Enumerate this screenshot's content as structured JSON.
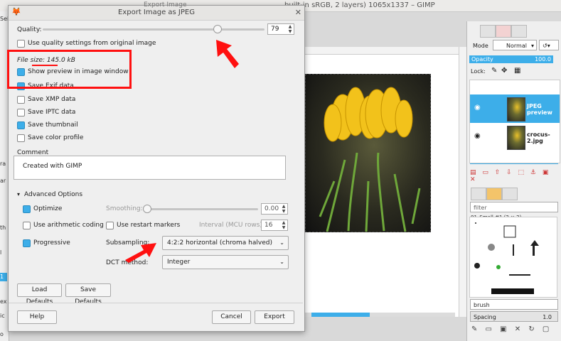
{
  "background_window": {
    "title": "built-in sRGB, 2 layers) 1065x1337 – GIMP",
    "left_strip": [
      "Sel",
      "ra",
      "ar",
      "th",
      "l",
      "1",
      "ex",
      "ic",
      "o"
    ],
    "layers_panel": {
      "mode_label": "Mode",
      "mode_value": "Normal",
      "opacity_label": "Opacity",
      "opacity_value": "100.0",
      "lock_label": "Lock:",
      "layers": [
        {
          "name": "JPEG preview"
        },
        {
          "name": "crocus-2.jpg"
        }
      ]
    },
    "brushes_panel": {
      "filter_placeholder": "filter",
      "brush_name": "01_Small #1 (2 × 2)",
      "brush_select": "brush",
      "spacing_label": "Spacing",
      "spacing_value": "1.0"
    }
  },
  "dialog": {
    "title": "Export Image as JPEG",
    "behind_title": "Export Image",
    "quality_label": "Quality:",
    "quality_value": "79",
    "quality_fraction": 0.79,
    "use_quality_settings": {
      "label": "Use quality settings from original image",
      "checked": false
    },
    "file_size": "File size: 145.0 kB",
    "show_preview": {
      "label": "Show preview in image window",
      "checked": true
    },
    "save_exif": {
      "label": "Save Exif data",
      "checked": true
    },
    "save_xmp": {
      "label": "Save XMP data",
      "checked": false
    },
    "save_iptc": {
      "label": "Save IPTC data",
      "checked": false
    },
    "save_thumbnail": {
      "label": "Save thumbnail",
      "checked": true
    },
    "save_color_profile": {
      "label": "Save color profile",
      "checked": false
    },
    "comment_label": "Comment",
    "comment_value": "Created with GIMP",
    "advanced_label": "Advanced Options",
    "optimize": {
      "label": "Optimize",
      "checked": true
    },
    "smoothing_label": "Smoothing:",
    "smoothing_value": "0.00",
    "arithmetic": {
      "label": "Use arithmetic coding",
      "checked": false
    },
    "restart": {
      "label": "Use restart markers",
      "checked": false
    },
    "interval_label": "Interval (MCU rows):",
    "interval_value": "16",
    "progressive": {
      "label": "Progressive",
      "checked": true
    },
    "subsampling_label": "Subsampling:",
    "subsampling_value": "4:2:2 horizontal (chroma halved)",
    "dct_label": "DCT method:",
    "dct_value": "Integer",
    "load_defaults": "Load Defaults",
    "save_defaults": "Save Defaults",
    "help": "Help",
    "cancel": "Cancel",
    "export": "Export"
  },
  "colors": {
    "accent": "#3daee9",
    "annotation": "#ff1010"
  }
}
